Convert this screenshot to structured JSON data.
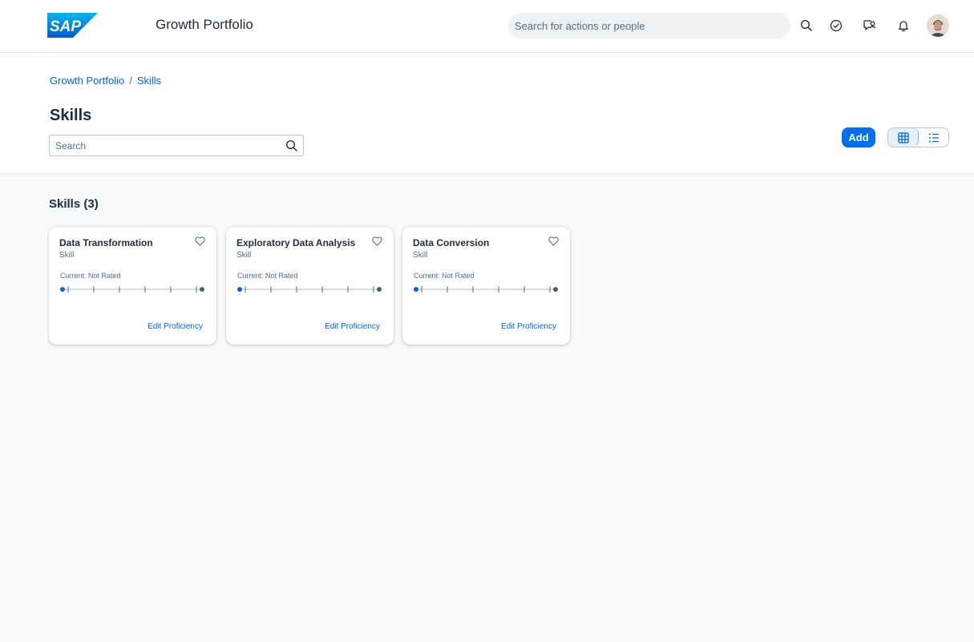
{
  "shellbar": {
    "logo_text": "SAP",
    "app_title": "Growth Portfolio",
    "search_placeholder": "Search for actions or people",
    "brand_color": "#0070f2",
    "icons": [
      "search-icon",
      "check-circle-icon",
      "chat-person-icon",
      "bell-icon"
    ]
  },
  "breadcrumb": {
    "items": [
      "Growth Portfolio",
      "Skills"
    ],
    "separator": "/"
  },
  "page": {
    "title": "Skills",
    "search_placeholder": "Search",
    "add_label": "Add",
    "view_modes": [
      "grid-view-icon",
      "list-view-icon"
    ],
    "active_view": "grid"
  },
  "section": {
    "title": "Skills (3)"
  },
  "cards": [
    {
      "title": "Data Transformation",
      "subtitle": "Skill",
      "current": "Current: Not Rated",
      "action": "Edit Proficiency"
    },
    {
      "title": "Exploratory Data Analysis",
      "subtitle": "Skill",
      "current": "Current: Not Rated",
      "action": "Edit Proficiency"
    },
    {
      "title": "Data Conversion",
      "subtitle": "Skill",
      "current": "Current: Not Rated",
      "action": "Edit Proficiency"
    }
  ]
}
